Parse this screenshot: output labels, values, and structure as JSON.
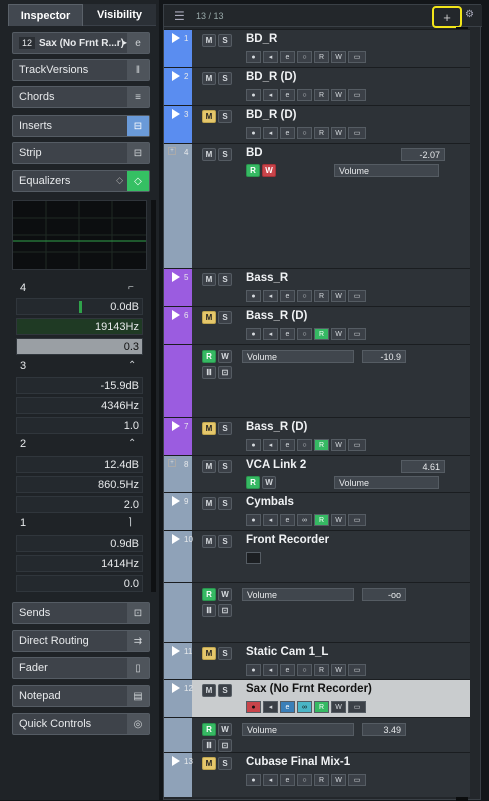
{
  "inspector": {
    "tabs": [
      "Inspector",
      "Visibility"
    ],
    "track_number": "12",
    "track_name": "Sax (No Frnt R...r)",
    "sections": {
      "track_versions": "TrackVersions",
      "chords": "Chords",
      "inserts": "Inserts",
      "strip": "Strip",
      "equalizers": "Equalizers",
      "sends": "Sends",
      "direct_routing": "Direct Routing",
      "fader": "Fader",
      "notepad": "Notepad",
      "quick_controls": "Quick Controls"
    },
    "eq_bands": [
      {
        "band": "4",
        "gain": "0.0dB",
        "freq": "19143Hz",
        "q": "0.3"
      },
      {
        "band": "3",
        "gain": "-15.9dB",
        "freq": "4346Hz",
        "q": "1.0"
      },
      {
        "band": "2",
        "gain": "12.4dB",
        "freq": "860.5Hz",
        "q": "2.0"
      },
      {
        "band": "1",
        "gain": "0.9dB",
        "freq": "1414Hz",
        "q": "0.0"
      }
    ]
  },
  "tracklist": {
    "count": "13 / 13",
    "add_label": "+",
    "tracks": [
      {
        "num": "1",
        "name": "BD_R",
        "color": "#5a8df0"
      },
      {
        "num": "2",
        "name": "BD_R (D)",
        "color": "#5a8df0"
      },
      {
        "num": "3",
        "name": "BD_R (D)",
        "color": "#5a8df0"
      },
      {
        "num": "4",
        "name": "BD",
        "value": "-2.07",
        "automation": "Volume",
        "color": "#8fa2b8"
      },
      {
        "num": "5",
        "name": "Bass_R",
        "color": "#9b5ce0"
      },
      {
        "num": "6",
        "name": "Bass_R (D)",
        "color": "#9b5ce0"
      },
      {
        "num": "",
        "name": "",
        "automation": "Volume",
        "value": "-10.9",
        "color": "#9b5ce0"
      },
      {
        "num": "7",
        "name": "Bass_R (D)",
        "color": "#9b5ce0"
      },
      {
        "num": "8",
        "name": "VCA Link 2",
        "value": "4.61",
        "automation": "Volume",
        "color": "#8fa2b8"
      },
      {
        "num": "9",
        "name": "Cymbals",
        "color": "#8fa2b8"
      },
      {
        "num": "10",
        "name": "Front Recorder",
        "color": "#8fa2b8"
      },
      {
        "num": "",
        "name": "",
        "automation": "Volume",
        "value": "-oo",
        "color": "#8fa2b8"
      },
      {
        "num": "11",
        "name": "Static Cam 1_L",
        "color": "#8fa2b8"
      },
      {
        "num": "12",
        "name": "Sax (No Frnt Recorder)",
        "color": "#8fa2b8"
      },
      {
        "num": "",
        "name": "",
        "automation": "Volume",
        "value": "3.49",
        "color": "#8fa2b8"
      },
      {
        "num": "13",
        "name": "Cubase Final Mix-1",
        "color": "#8fa2b8"
      }
    ],
    "button_labels": {
      "mute": "M",
      "solo": "S",
      "read": "R",
      "write": "W"
    }
  }
}
